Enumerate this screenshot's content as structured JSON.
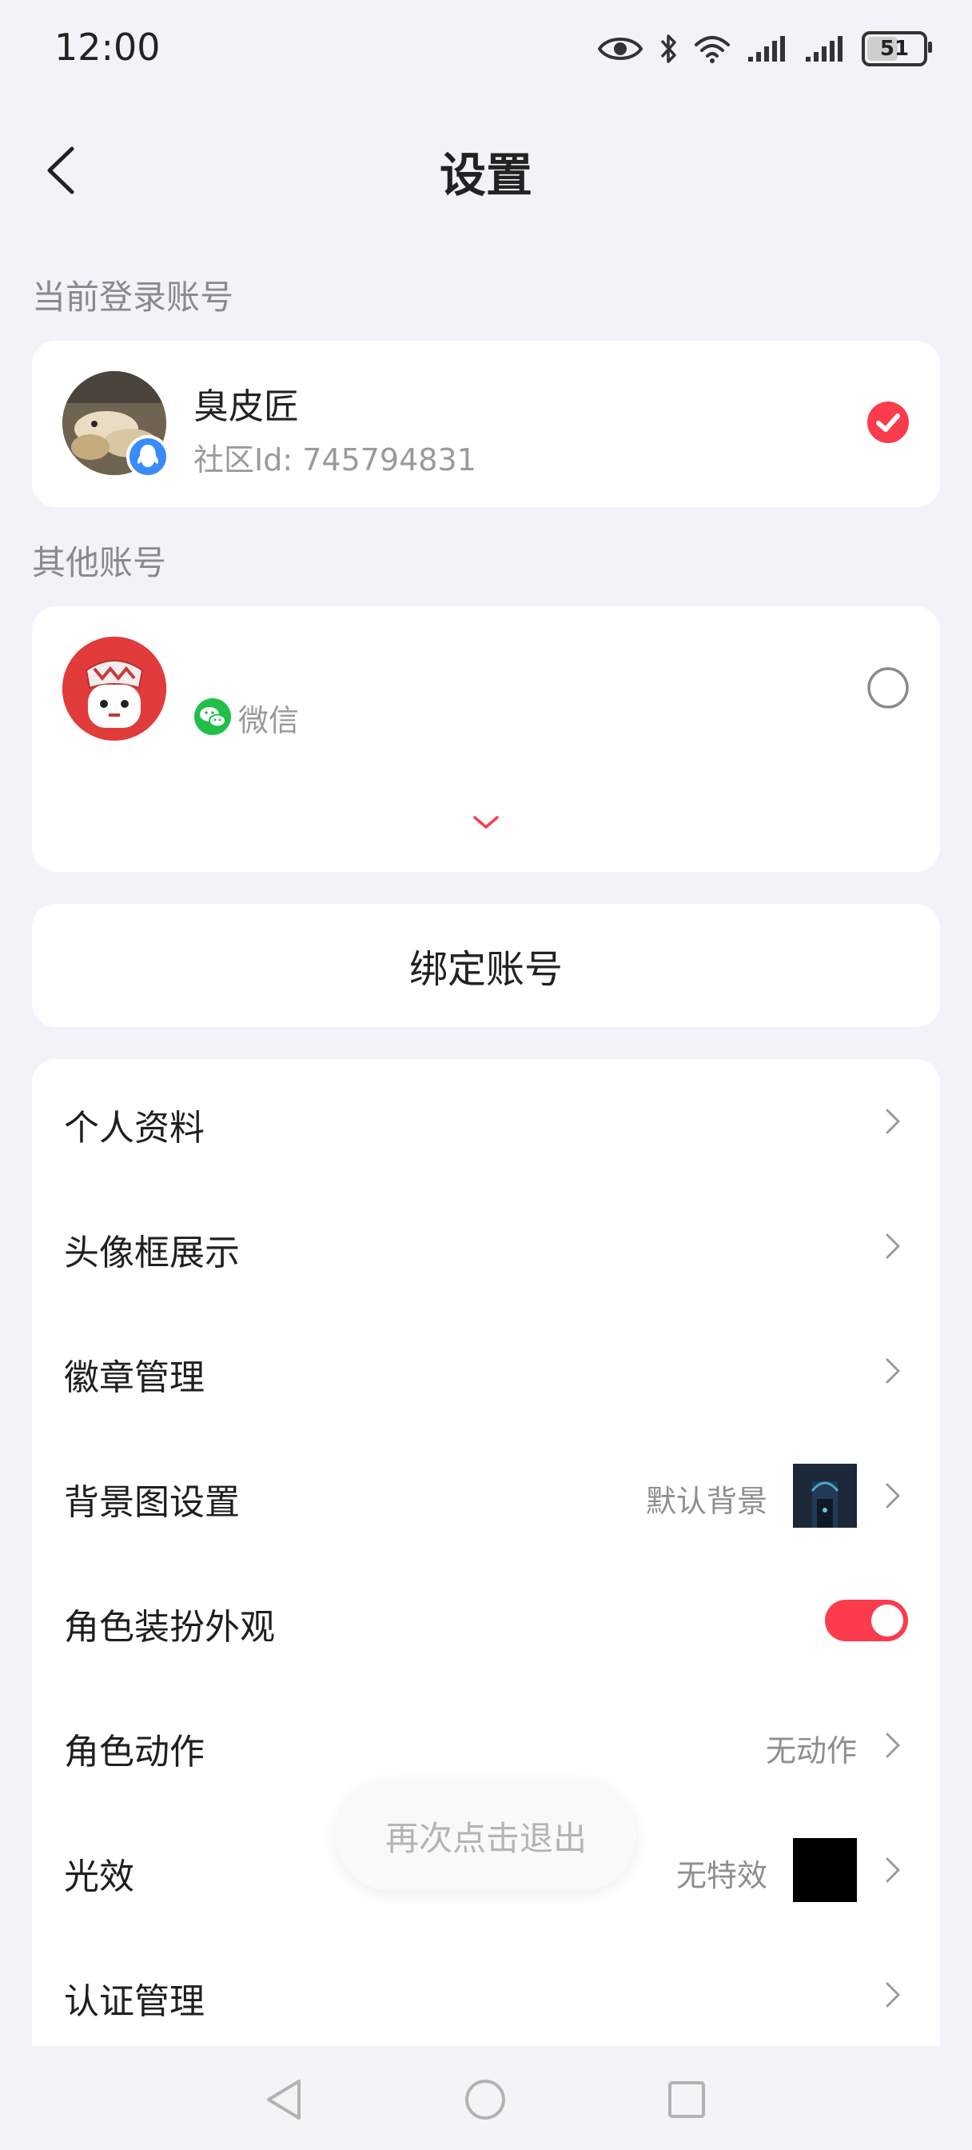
{
  "status_bar": {
    "time": "12:00",
    "battery": "51"
  },
  "header": {
    "title": "设置"
  },
  "current_account": {
    "section_label": "当前登录账号",
    "name": "臭皮匠",
    "community_id": "社区Id: 745794831"
  },
  "other_accounts": {
    "section_label": "其他账号",
    "items": [
      {
        "name": "",
        "platform": "微信"
      }
    ]
  },
  "bind_account": {
    "label": "绑定账号"
  },
  "settings": [
    {
      "label": "个人资料"
    },
    {
      "label": "头像框展示"
    },
    {
      "label": "徽章管理"
    },
    {
      "label": "背景图设置",
      "value": "默认背景"
    },
    {
      "label": "角色装扮外观",
      "toggle": true
    },
    {
      "label": "角色动作",
      "value": "无动作"
    },
    {
      "label": "光效",
      "value": "无特效"
    },
    {
      "label": "认证管理"
    }
  ],
  "toast": {
    "text": "再次点击退出"
  },
  "colors": {
    "accent": "#fa3c4c",
    "wechat_green": "#1fbf48",
    "qq_blue": "#3a8bfa",
    "background": "#f1f3f9"
  }
}
